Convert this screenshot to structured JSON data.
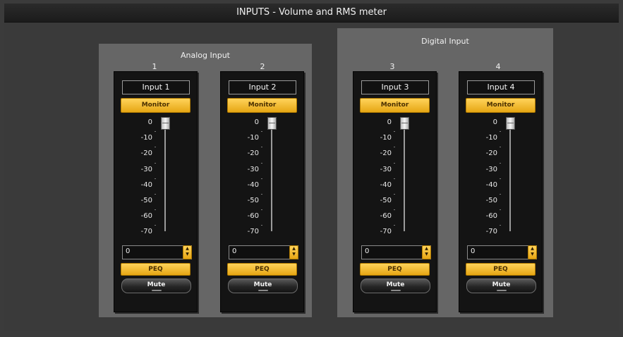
{
  "window": {
    "title": "INPUTS - Volume and RMS meter"
  },
  "groups": {
    "analog": {
      "title": "Analog Input"
    },
    "digital": {
      "title": "Digital Input"
    }
  },
  "scale_labels": [
    "0",
    "-10",
    "-20",
    "-30",
    "-40",
    "-50",
    "-60",
    "-70"
  ],
  "channels": [
    {
      "number": "1",
      "name": "Input 1",
      "monitor_label": "Monitor",
      "volume_db": 0,
      "spin_value": "0",
      "peq_label": "PEQ",
      "mute_label": "Mute"
    },
    {
      "number": "2",
      "name": "Input 2",
      "monitor_label": "Monitor",
      "volume_db": 0,
      "spin_value": "0",
      "peq_label": "PEQ",
      "mute_label": "Mute"
    },
    {
      "number": "3",
      "name": "Input 3",
      "monitor_label": "Monitor",
      "volume_db": 0,
      "spin_value": "0",
      "peq_label": "PEQ",
      "mute_label": "Mute"
    },
    {
      "number": "4",
      "name": "Input 4",
      "monitor_label": "Monitor",
      "volume_db": 0,
      "spin_value": "0",
      "peq_label": "PEQ",
      "mute_label": "Mute"
    }
  ],
  "colors": {
    "accent": "#f2b632",
    "strip_background": "#141414",
    "group_background": "#666666"
  }
}
